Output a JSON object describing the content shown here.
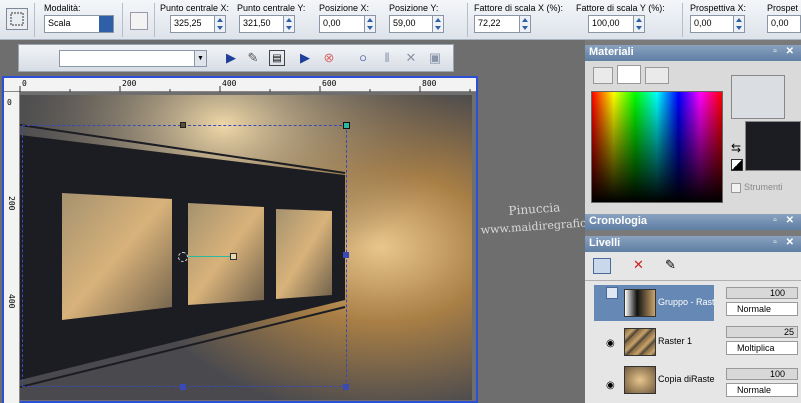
{
  "options_bar": {
    "mode_label": "Modalità:",
    "mode_value": "Scala",
    "fields": [
      {
        "label": "Punto centrale X:",
        "value": "325,25"
      },
      {
        "label": "Punto centrale Y:",
        "value": "321,50"
      },
      {
        "label": "Posizione X:",
        "value": "0,00"
      },
      {
        "label": "Posizione Y:",
        "value": "59,00"
      },
      {
        "label": "Fattore di scala X (%):",
        "value": "72,22"
      },
      {
        "label": "Fattore di scala Y (%):",
        "value": "100,00"
      },
      {
        "label": "Prospettiva X:",
        "value": "0,00"
      },
      {
        "label": "Prospet",
        "value": "0,00"
      }
    ]
  },
  "ruler": {
    "top_labels": [
      "0",
      "200",
      "400",
      "600",
      "800"
    ],
    "left_labels": [
      "0",
      "200",
      "400"
    ]
  },
  "watermark": {
    "line1": "Pinuccia",
    "line2": "www.maidiregrafica.eu"
  },
  "panels": {
    "materiali": {
      "title": "Materiali",
      "strumenti_label": "Strumenti"
    },
    "cronologia": {
      "title": "Cronologia"
    },
    "livelli": {
      "title": "Livelli",
      "layers": [
        {
          "name": "Gruppo - Rast",
          "opacity": "100",
          "blend": "Normale"
        },
        {
          "name": "Raster 1",
          "opacity": "25",
          "blend": "Moltiplica"
        },
        {
          "name": "Copia diRaste",
          "opacity": "100",
          "blend": "Normale"
        }
      ]
    },
    "panel_controls": "▫ ✕"
  },
  "colors": {
    "selection_blue": "#2d4fd6",
    "accent_title": "#6a86aa",
    "art_gold": "#c09a5c",
    "art_dark": "#1c1d22"
  }
}
